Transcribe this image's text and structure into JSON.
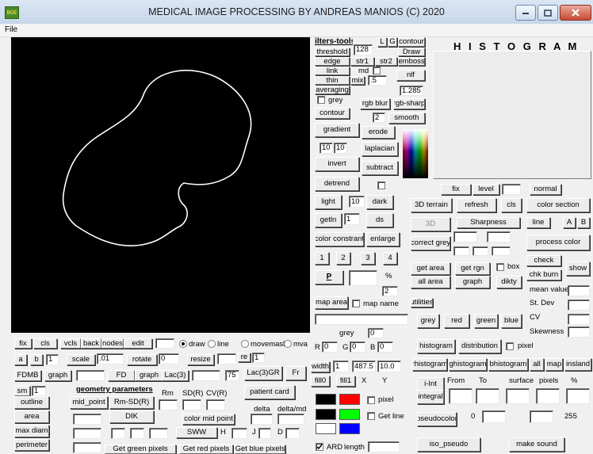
{
  "window": {
    "title": "MEDICAL IMAGE PROCESSING BY ANDREAS MANIOS (C) 2020",
    "icon_text": "BGE"
  },
  "menu": {
    "file": "File"
  },
  "filters": {
    "filters_tools": "filters-tools",
    "l": "L",
    "g": "G",
    "contour_top": "contour",
    "draw": "Draw",
    "threshold": "threshold",
    "threshold_value": "128",
    "edge": "edge",
    "str1": "str1",
    "str2": "str2",
    "emboss": "emboss",
    "link": "link",
    "md": "md",
    "nlf": "nlf",
    "thin": "thin",
    "mix": "mix",
    "mix_value": ".5",
    "value_1285": "1.285",
    "averaging": "averaging",
    "grey": "grey",
    "rgb_blur": "rgb blur",
    "rgb_sharp": "rgb-sharp",
    "contour": "contour",
    "contour_value": "2",
    "smooth": "smooth",
    "gradient": "gradient",
    "erode": "erode",
    "lap_a": "10",
    "lap_b": "10",
    "laplacian": "laplacian",
    "invert": "invert",
    "subtract": "subtract",
    "detrend": "detrend",
    "light": "light",
    "light_value": "10",
    "dark": "dark",
    "getln": "getln",
    "getln_value": "1",
    "ds": "ds",
    "color_constrant": "color constrant",
    "enlarge": "enlarge",
    "n1": "1",
    "n2": "2",
    "n3": "3",
    "n4": "4",
    "p": "P",
    "percent": "%",
    "percent_value": "2",
    "map_area": "map area",
    "map_name": "map name",
    "grey_label": "grey",
    "grey_value": "0"
  },
  "histogram": {
    "title": "H I S T O G R A M",
    "fix": "fix",
    "level": "level",
    "normal": "normal",
    "terrain3d": "3D terrain",
    "refresh": "refresh",
    "cls": "cls",
    "color_section": "color section",
    "btn3d": "3D",
    "sharpness": "Sharpness",
    "line": "line",
    "a": "A",
    "b": "B",
    "correct_grey": "correct grey",
    "process_color": "process color",
    "get_area": "get area",
    "get_rgn": "get rgn",
    "box": "box",
    "check": "check",
    "show": "show",
    "chk_burn": "chk burn",
    "all_area": "all area",
    "graph": "graph",
    "dikty": "dikty",
    "mean_value": "mean value",
    "utilities": "utilities",
    "st_dev": "St. Dev",
    "grey": "grey",
    "red": "red",
    "green": "green",
    "blue": "blue",
    "cv": "CV",
    "skewness": "Skewness"
  },
  "rgb_row": {
    "r": "R",
    "r_val": "0",
    "g": "G",
    "g_val": "0",
    "b": "B",
    "b_val": "0",
    "histogram": "histogram",
    "distribution": "distribution",
    "pixel": "pixel"
  },
  "width_row": {
    "width": "width",
    "width_val": "1",
    "v1": "487.5",
    "v2": "10.0",
    "rhistogram": "rhistogram",
    "ghistogram": "ghistogram",
    "bhistogram": "bhistogram",
    "all": "all",
    "map": "map",
    "insland": "insland"
  },
  "fill_row": {
    "fill0": "fill0",
    "fill1": "fill1",
    "x": "X",
    "y": "Y",
    "i_int": "i-Int",
    "from": "From",
    "to": "To",
    "surface": "surface",
    "pixels": "pixels",
    "pct": "%"
  },
  "color_boxes": {
    "pixel": "pixel",
    "integral": "integral",
    "get_line": "Get line",
    "pseudocolor": "pseudocolor",
    "pc_a": "0",
    "pc_b": "255",
    "ard": "ARD",
    "length": "length",
    "iso_pseudo": "iso_pseudo",
    "make_sound": "make sound",
    "colors": {
      "black": "#000000",
      "red": "#ff0000",
      "green": "#00ff00",
      "blue": "#0000ff",
      "white": "#ffffff"
    }
  },
  "bottom": {
    "fix": "fix",
    "cls": "cls",
    "vcls": "vcls",
    "back": "back",
    "nodes": "nodes",
    "edit": "edit",
    "draw": "draw",
    "line": "line",
    "movemask": "movemask",
    "mva": "mva",
    "a": "a",
    "b": "b",
    "one": "1",
    "scale": "scale",
    "scale_val": ".01",
    "rotate": "rotate",
    "rotate_val": "0",
    "resize": "resize",
    "re": "re",
    "re_val": "1",
    "fdmb": "FDMB",
    "graph": "graph",
    "fd": "FD",
    "graph2": "graph",
    "lac3": "Lac(3)",
    "val75": "75",
    "lac3gr": "Lac(3)GR",
    "fr": "Fr",
    "sm": "sm",
    "sm_val": "1",
    "geometry": "geometry parameters",
    "rm": "Rm",
    "sdr": "SD(R)",
    "cvr": "CV(R)",
    "patient_card": "patient card",
    "outline": "outline",
    "mid_point": "mid_point",
    "rm_sdr": "Rm-SD(R)",
    "delta": "delta",
    "delta_md": "delta/md",
    "area": "area",
    "dik": "DIK",
    "color_mid_point": "color mid point",
    "max_diam": "max diam",
    "sww": "SWW",
    "h": "H",
    "j": "J",
    "d": "D",
    "perimeter": "perimeter",
    "get_green": "Get green pixels",
    "get_red": "Get red pixels",
    "get_blue": "Get blue pixels"
  }
}
